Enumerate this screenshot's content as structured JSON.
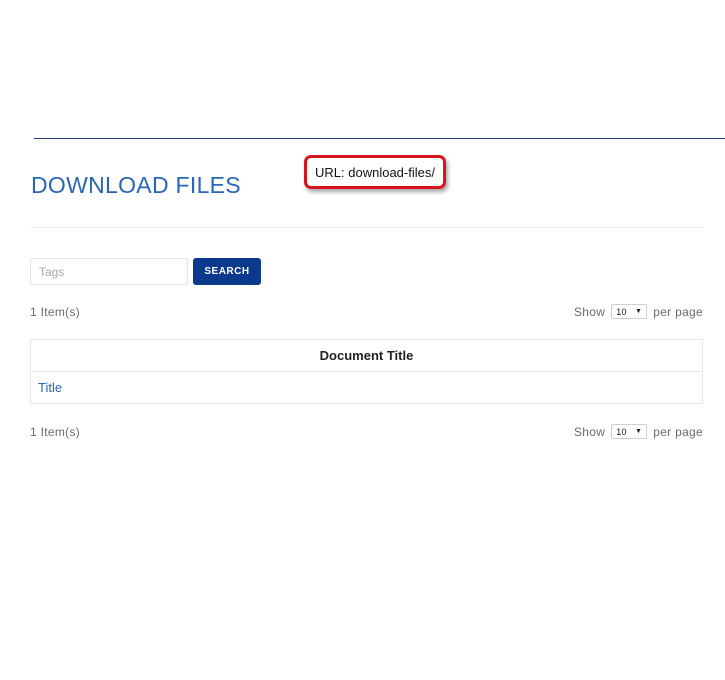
{
  "callout": {
    "text": "URL: download-files/"
  },
  "page": {
    "title": "DOWNLOAD FILES"
  },
  "search": {
    "placeholder": "Tags",
    "button_label": "SEARCH"
  },
  "listing": {
    "count_text": "1 Item(s)",
    "show_label": "Show",
    "per_page_value": "10",
    "per_page_label": "per page",
    "column_header": "Document Title",
    "rows": [
      {
        "title": "Title"
      }
    ]
  }
}
